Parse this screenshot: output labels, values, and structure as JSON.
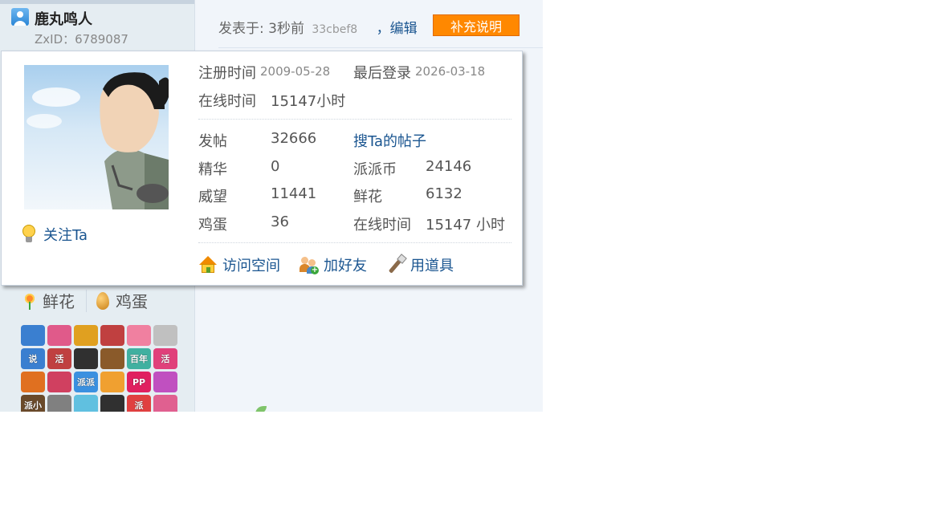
{
  "author": {
    "username": "鹿丸鸣人",
    "zxid": "ZxID：6789087"
  },
  "post": {
    "posted_prefix": "发表于: 3秒前",
    "hash": "33cbef8",
    "edit_label": "，编辑",
    "supplement_label": "补充说明"
  },
  "popup": {
    "register_label": "注册时间",
    "register_value": "2009-05-28",
    "last_login_label": "最后登录",
    "last_login_value": "2026-03-18",
    "online_label": "在线时间",
    "online_value": "15147小时",
    "follow_label": "关注Ta",
    "stats": {
      "posts_label": "发帖",
      "posts_value": "32666",
      "search_posts_link": "搜Ta的帖子",
      "digest_label": "精华",
      "digest_value": "0",
      "coins_label": "派派币",
      "coins_value": "24146",
      "prestige_label": "威望",
      "prestige_value": "11441",
      "flowers_label": "鲜花",
      "flowers_value": "6132",
      "eggs_label": "鸡蛋",
      "eggs_value": "36",
      "online2_label": "在线时间",
      "online2_value": "15147 小时"
    },
    "actions": {
      "visit_space": "访问空间",
      "add_friend": "加好友",
      "use_item": "用道具"
    },
    "icons": [
      "bulb-icon",
      "home-icon",
      "friends-icon",
      "wand-icon"
    ]
  },
  "gifts": {
    "flower_label": "鲜花",
    "egg_label": "鸡蛋"
  },
  "medals": [
    {
      "text": "",
      "color": "#3a7fd0"
    },
    {
      "text": "",
      "color": "#e05a8a"
    },
    {
      "text": "",
      "color": "#e0a020"
    },
    {
      "text": "",
      "color": "#c04040"
    },
    {
      "text": "",
      "color": "#f080a0"
    },
    {
      "text": "",
      "color": "#c0c0c0"
    },
    {
      "text": "说",
      "color": "#3a7fd0"
    },
    {
      "text": "活",
      "color": "#c04040"
    },
    {
      "text": "",
      "color": "#303030"
    },
    {
      "text": "",
      "color": "#8a5a2a"
    },
    {
      "text": "百年",
      "color": "#40b0a0"
    },
    {
      "text": "活",
      "color": "#e0407a"
    },
    {
      "text": "",
      "color": "#e07020"
    },
    {
      "text": "",
      "color": "#d04060"
    },
    {
      "text": "派派",
      "color": "#3a90e0"
    },
    {
      "text": "",
      "color": "#f0a030"
    },
    {
      "text": "PP",
      "color": "#e02060"
    },
    {
      "text": "",
      "color": "#c050c0"
    },
    {
      "text": "派小",
      "color": "#6a4a2a"
    },
    {
      "text": "",
      "color": "#808080"
    },
    {
      "text": "",
      "color": "#60c0e0"
    },
    {
      "text": "",
      "color": "#303030"
    },
    {
      "text": "派",
      "color": "#e04040"
    },
    {
      "text": "",
      "color": "#e06090"
    }
  ],
  "colors": {
    "accent_button": "#ff8800",
    "link": "#1a5590",
    "author_bg": "#e5edf2",
    "post_bg": "#f1f5fa"
  }
}
